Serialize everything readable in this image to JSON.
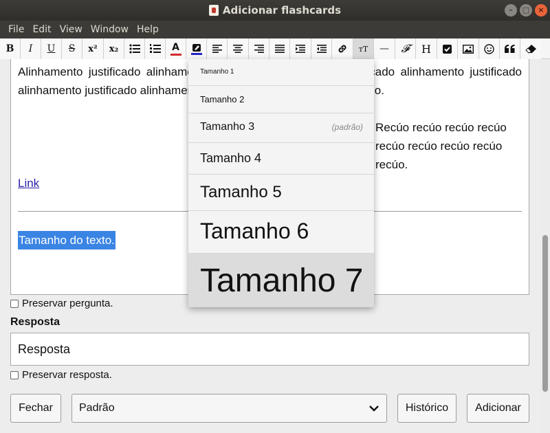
{
  "window": {
    "title": "Adicionar flashcards"
  },
  "menubar": [
    "File",
    "Edit",
    "Window",
    "Help"
  ],
  "menubar_items": [
    {
      "label": "File"
    },
    {
      "label": "Edit"
    },
    {
      "label": "View"
    },
    {
      "label": "Window"
    },
    {
      "label": "Help"
    }
  ],
  "toolbar": {
    "bold": "B",
    "italic": "I",
    "underline": "U",
    "strike": "S",
    "superscript": "x²",
    "subscript": "x₂",
    "fontsize_glyph": "ᴛT",
    "hr_glyph": "—",
    "mathjax_glyph": "𝓕",
    "html_glyph": "H",
    "text_color": "#d42a2a",
    "highlight_color": "#2424c8"
  },
  "editor": {
    "justified_text": "Alinhamento justificado alinhamento justificado alinhamento justificado alinhamento justificado alinhamento justificado alinhamento justificado alinhamento justificado.",
    "recuo_text": "Recúo recúo recúo recúo recúo recúo recúo recúo recúo.",
    "link_text": "Link",
    "selected_text": "Tamanho do texto."
  },
  "size_dropdown": {
    "options": [
      {
        "label": "Tamanho 1"
      },
      {
        "label": "Tamanho 2"
      },
      {
        "label": "Tamanho 3",
        "note": "(padrão)"
      },
      {
        "label": "Tamanho 4"
      },
      {
        "label": "Tamanho 5"
      },
      {
        "label": "Tamanho 6"
      },
      {
        "label": "Tamanho 7"
      }
    ]
  },
  "form": {
    "preserve_question": "Preservar pergunta.",
    "answer_heading": "Resposta",
    "answer_value": "Resposta",
    "preserve_answer": "Preservar resposta."
  },
  "footer": {
    "close": "Fechar",
    "deck_select": "Padrão",
    "history": "Histórico",
    "add": "Adicionar"
  }
}
